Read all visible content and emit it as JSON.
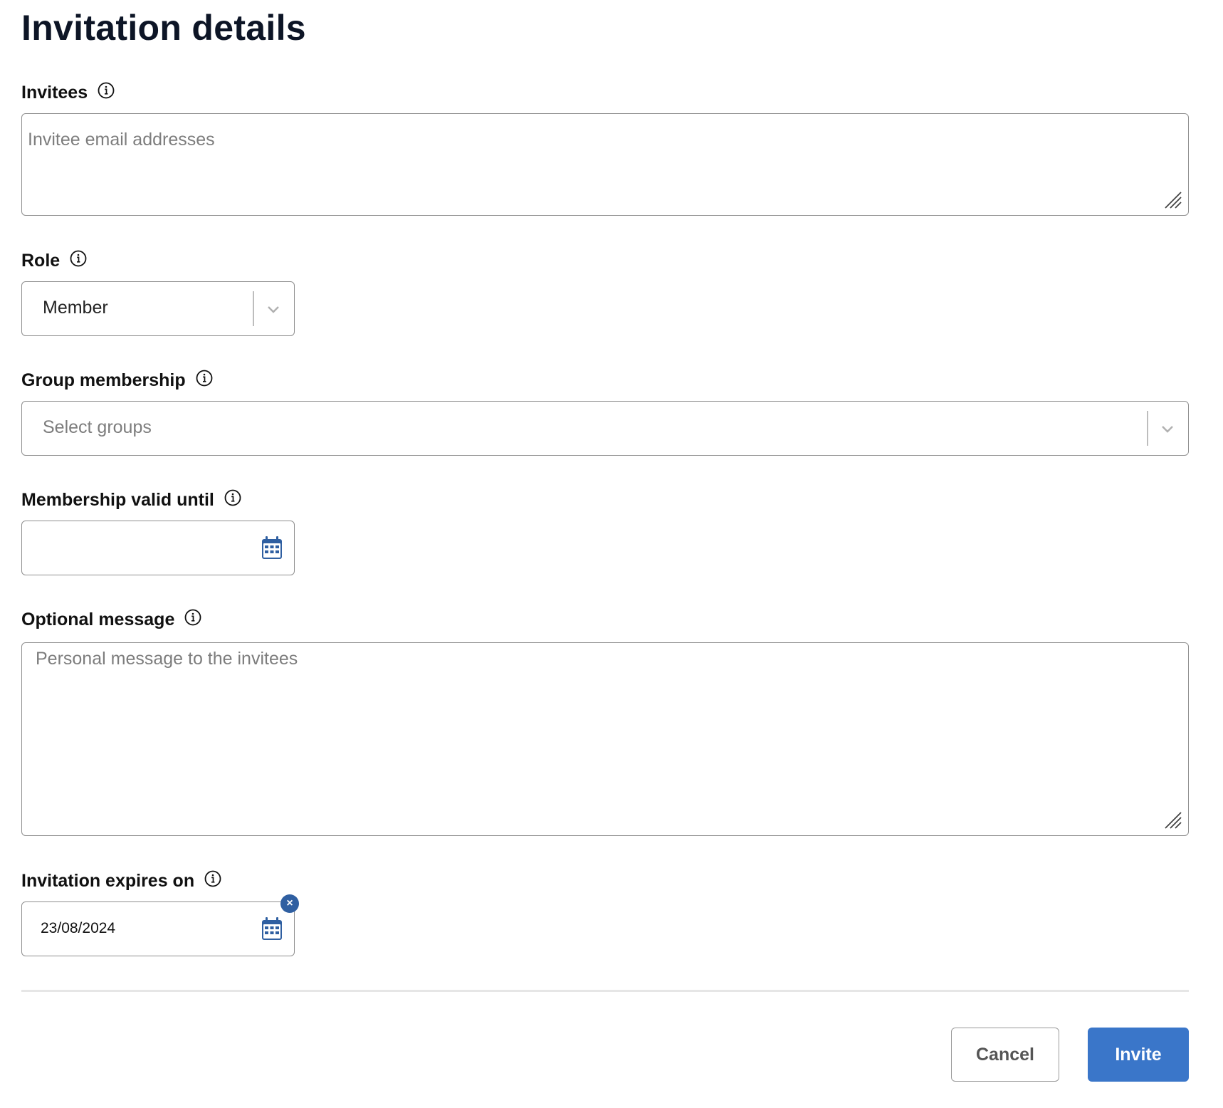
{
  "form": {
    "title": "Invitation details",
    "invitees": {
      "label": "Invitees",
      "placeholder": "Invitee email addresses",
      "value": ""
    },
    "role": {
      "label": "Role",
      "selected": "Member"
    },
    "group_membership": {
      "label": "Group membership",
      "placeholder": "Select groups"
    },
    "membership_valid_until": {
      "label": "Membership valid until",
      "value": ""
    },
    "optional_message": {
      "label": "Optional message",
      "placeholder": "Personal message to the invitees",
      "value": ""
    },
    "invitation_expires_on": {
      "label": "Invitation expires on",
      "value": "23/08/2024",
      "clear_symbol": "×"
    }
  },
  "actions": {
    "cancel_label": "Cancel",
    "invite_label": "Invite"
  },
  "colors": {
    "accent": "#3a76c9",
    "icon_blue": "#2f5fa1",
    "border": "#8f8f8f",
    "placeholder": "#7d7d7d"
  },
  "icons": {
    "info": "info-circle-icon",
    "calendar": "calendar-icon",
    "chevron": "chevron-down-icon",
    "clear": "close-icon",
    "resize": "resize-grip-icon"
  }
}
